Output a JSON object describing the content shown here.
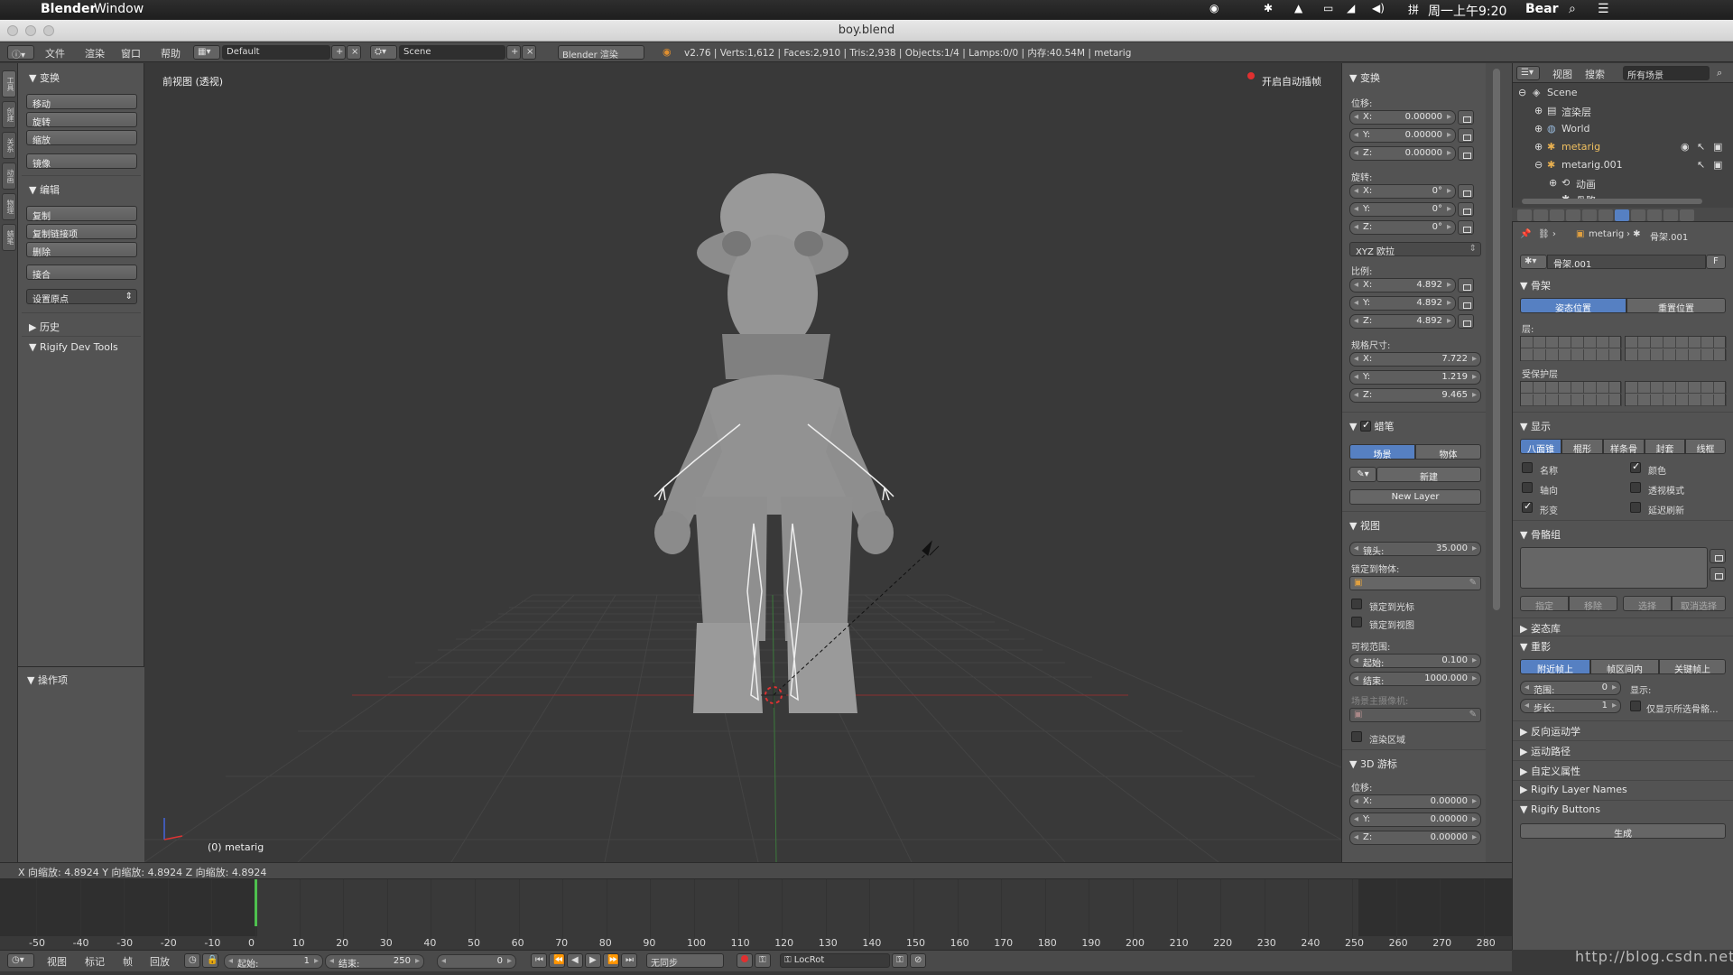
{
  "mac": {
    "app": "Blender",
    "window_menu": "Window",
    "clock": "周一上午9:20",
    "user": "Bear",
    "window_title": "boy.blend"
  },
  "top_header": {
    "menus": [
      "文件",
      "渲染",
      "窗口",
      "帮助"
    ],
    "layout": "Default",
    "scene": "Scene",
    "engine": "Blender 渲染",
    "stats": "v2.76 | Verts:1,612 | Faces:2,910 | Tris:2,938 | Objects:1/4 | Lamps:0/0 | 内存:40.54M | metarig"
  },
  "tool_tabs": [
    "工具",
    "创建",
    "关系",
    "动画",
    "物理",
    "蜡笔"
  ],
  "shelf": {
    "transform_title": "变换",
    "transform_buttons": [
      "移动",
      "旋转",
      "缩放",
      "镜像"
    ],
    "edit_title": "编辑",
    "edit_buttons": [
      "复制",
      "复制链接项",
      "删除",
      "接合"
    ],
    "set_origin": "设置原点",
    "history": "历史",
    "rigify": "Rigify Dev Tools",
    "operator": "操作项"
  },
  "viewport": {
    "view_label": "前视图 (透视)",
    "autokey": "开启自动插帧",
    "object_label": "(0) metarig"
  },
  "npanel": {
    "transform": "变换",
    "location": "位移:",
    "loc": [
      "0.00000",
      "0.00000",
      "0.00000"
    ],
    "rotation": "旋转:",
    "rot": [
      "0°",
      "0°",
      "0°"
    ],
    "rot_mode": "XYZ 欧拉",
    "scale": "比例:",
    "scl": [
      "4.892",
      "4.892",
      "4.892"
    ],
    "dimensions": "规格尺寸:",
    "dim": [
      "7.722",
      "1.219",
      "9.465"
    ],
    "axes": [
      "X:",
      "Y:",
      "Z:"
    ],
    "grease_pencil": "蜡笔",
    "gp_scene": "场景",
    "gp_object": "物体",
    "gp_new": "新建",
    "gp_new_layer": "New Layer",
    "view": "视图",
    "lens_label": "镜头:",
    "lens": "35.000",
    "lock_object": "锁定到物体:",
    "lock_cursor": "锁定到光标",
    "lock_view": "锁定到视图",
    "clip": "可视范围:",
    "clip_start_label": "起始:",
    "clip_start": "0.100",
    "clip_end_label": "结束:",
    "clip_end": "1000.000",
    "local_camera": "场景主摄像机:",
    "render_border": "渲染区域",
    "cursor": "3D 游标",
    "cursor_loc": "位移:",
    "cur": [
      "0.00000",
      "0.00000",
      "0.00000"
    ]
  },
  "outliner": {
    "view": "视图",
    "search": "搜索",
    "filter": "所有场景",
    "rows": [
      "Scene",
      "渲染层",
      "World",
      "metarig",
      "metarig.001",
      "动画",
      "骨骼"
    ]
  },
  "props": {
    "crumb_obj": "metarig",
    "crumb_arm": "骨架.001",
    "name": "骨架.001",
    "fake_user": "F",
    "skeleton": "骨架",
    "pose_position": "姿态位置",
    "rest_position": "重置位置",
    "layers": "层:",
    "protected": "受保护层",
    "display": "显示",
    "display_types": [
      "八面锥",
      "棍形",
      "样条骨",
      "封套",
      "线框"
    ],
    "show_names": "名称",
    "show_colors": "颜色",
    "show_axes": "轴向",
    "xray": "透视模式",
    "shapes": "形变",
    "delay": "延迟刷新",
    "bone_groups": "骨骼组",
    "bg_buttons": [
      "指定",
      "移除",
      "选择",
      "取消选择"
    ],
    "pose_library": "姿态库",
    "ghost": "重影",
    "ghost_types": [
      "附近帧上",
      "帧区间内",
      "关键帧上"
    ],
    "range_label": "范围:",
    "range": "0",
    "step_label": "步长:",
    "step": "1",
    "display_label": "显示:",
    "selected_only": "仅显示所选骨骼...",
    "ik": "反向运动学",
    "motion_paths": "运动路径",
    "custom_props": "自定义属性",
    "rigify_layers": "Rigify Layer Names",
    "rigify_buttons": "Rigify Buttons",
    "generate": "生成"
  },
  "status": "X 向缩放: 4.8924  Y 向缩放: 4.8924  Z 向缩放: 4.8924",
  "timeline": {
    "ticks": [
      "-50",
      "-40",
      "-30",
      "-20",
      "-10",
      "0",
      "10",
      "20",
      "30",
      "40",
      "50",
      "60",
      "70",
      "80",
      "90",
      "100",
      "110",
      "120",
      "130",
      "140",
      "150",
      "160",
      "170",
      "180",
      "190",
      "200",
      "210",
      "220",
      "230",
      "240",
      "250",
      "260",
      "270",
      "280"
    ],
    "current_frame": 0,
    "menus": [
      "视图",
      "标记",
      "帧",
      "回放"
    ],
    "start_label": "起始:",
    "start": "1",
    "end_label": "结束:",
    "end": "250",
    "current": "0",
    "sync": "无同步",
    "keying_set": "LocRot"
  },
  "watermark": "http://blog.csdn.net/"
}
